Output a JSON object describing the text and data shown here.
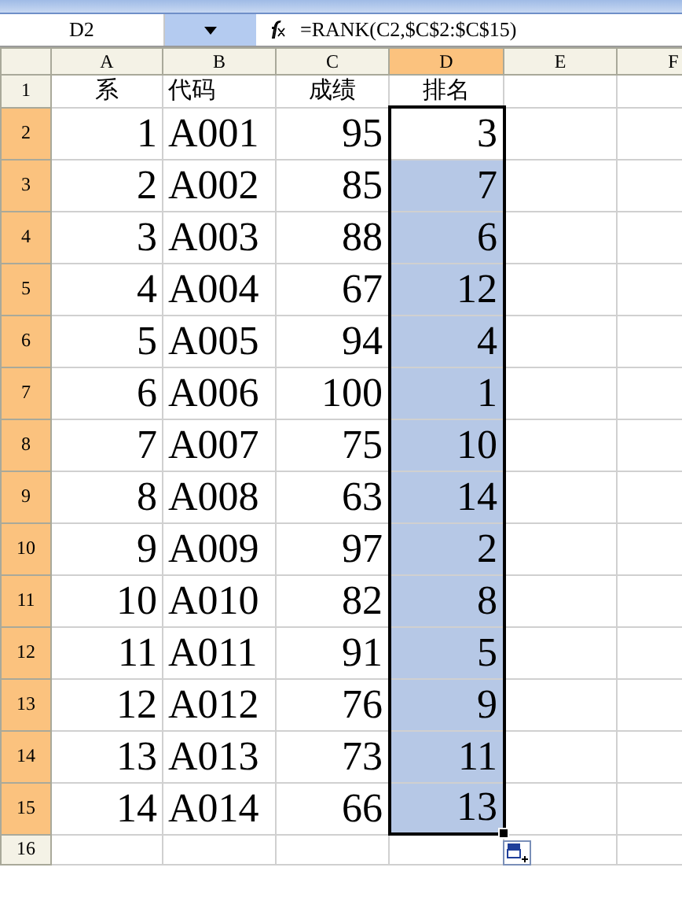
{
  "name_box": "D2",
  "formula": "=RANK(C2,$C$2:$C$15)",
  "columns": [
    {
      "label": "A",
      "selected": false
    },
    {
      "label": "B",
      "selected": false
    },
    {
      "label": "C",
      "selected": false
    },
    {
      "label": "D",
      "selected": true
    },
    {
      "label": "E",
      "selected": false
    },
    {
      "label": "F",
      "selected": false
    }
  ],
  "rows": [
    {
      "number": "1",
      "selected": false,
      "cells": [
        {
          "text": "系",
          "selected": false,
          "active": false
        },
        {
          "text": "代码",
          "selected": false,
          "active": false
        },
        {
          "text": "成绩",
          "selected": false,
          "active": false
        },
        {
          "text": "排名",
          "selected": false,
          "active": false
        }
      ]
    },
    {
      "number": "2",
      "selected": true,
      "cells": [
        {
          "text": "1",
          "selected": false,
          "active": false
        },
        {
          "text": "A001",
          "selected": false,
          "active": false
        },
        {
          "text": "95",
          "selected": false,
          "active": false
        },
        {
          "text": "3",
          "selected": true,
          "active": true
        }
      ]
    },
    {
      "number": "3",
      "selected": true,
      "cells": [
        {
          "text": "2",
          "selected": false,
          "active": false
        },
        {
          "text": "A002",
          "selected": false,
          "active": false
        },
        {
          "text": "85",
          "selected": false,
          "active": false
        },
        {
          "text": "7",
          "selected": true,
          "active": false
        }
      ]
    },
    {
      "number": "4",
      "selected": true,
      "cells": [
        {
          "text": "3",
          "selected": false,
          "active": false
        },
        {
          "text": "A003",
          "selected": false,
          "active": false
        },
        {
          "text": "88",
          "selected": false,
          "active": false
        },
        {
          "text": "6",
          "selected": true,
          "active": false
        }
      ]
    },
    {
      "number": "5",
      "selected": true,
      "cells": [
        {
          "text": "4",
          "selected": false,
          "active": false
        },
        {
          "text": "A004",
          "selected": false,
          "active": false
        },
        {
          "text": "67",
          "selected": false,
          "active": false
        },
        {
          "text": "12",
          "selected": true,
          "active": false
        }
      ]
    },
    {
      "number": "6",
      "selected": true,
      "cells": [
        {
          "text": "5",
          "selected": false,
          "active": false
        },
        {
          "text": "A005",
          "selected": false,
          "active": false
        },
        {
          "text": "94",
          "selected": false,
          "active": false
        },
        {
          "text": "4",
          "selected": true,
          "active": false
        }
      ]
    },
    {
      "number": "7",
      "selected": true,
      "cells": [
        {
          "text": "6",
          "selected": false,
          "active": false
        },
        {
          "text": "A006",
          "selected": false,
          "active": false
        },
        {
          "text": "100",
          "selected": false,
          "active": false
        },
        {
          "text": "1",
          "selected": true,
          "active": false
        }
      ]
    },
    {
      "number": "8",
      "selected": true,
      "cells": [
        {
          "text": "7",
          "selected": false,
          "active": false
        },
        {
          "text": "A007",
          "selected": false,
          "active": false
        },
        {
          "text": "75",
          "selected": false,
          "active": false
        },
        {
          "text": "10",
          "selected": true,
          "active": false
        }
      ]
    },
    {
      "number": "9",
      "selected": true,
      "cells": [
        {
          "text": "8",
          "selected": false,
          "active": false
        },
        {
          "text": "A008",
          "selected": false,
          "active": false
        },
        {
          "text": "63",
          "selected": false,
          "active": false
        },
        {
          "text": "14",
          "selected": true,
          "active": false
        }
      ]
    },
    {
      "number": "10",
      "selected": true,
      "cells": [
        {
          "text": "9",
          "selected": false,
          "active": false
        },
        {
          "text": "A009",
          "selected": false,
          "active": false
        },
        {
          "text": "97",
          "selected": false,
          "active": false
        },
        {
          "text": "2",
          "selected": true,
          "active": false
        }
      ]
    },
    {
      "number": "11",
      "selected": true,
      "cells": [
        {
          "text": "10",
          "selected": false,
          "active": false
        },
        {
          "text": "A010",
          "selected": false,
          "active": false
        },
        {
          "text": "82",
          "selected": false,
          "active": false
        },
        {
          "text": "8",
          "selected": true,
          "active": false
        }
      ]
    },
    {
      "number": "12",
      "selected": true,
      "cells": [
        {
          "text": "11",
          "selected": false,
          "active": false
        },
        {
          "text": "A011",
          "selected": false,
          "active": false
        },
        {
          "text": "91",
          "selected": false,
          "active": false
        },
        {
          "text": "5",
          "selected": true,
          "active": false
        }
      ]
    },
    {
      "number": "13",
      "selected": true,
      "cells": [
        {
          "text": "12",
          "selected": false,
          "active": false
        },
        {
          "text": "A012",
          "selected": false,
          "active": false
        },
        {
          "text": "76",
          "selected": false,
          "active": false
        },
        {
          "text": "9",
          "selected": true,
          "active": false
        }
      ]
    },
    {
      "number": "14",
      "selected": true,
      "cells": [
        {
          "text": "13",
          "selected": false,
          "active": false
        },
        {
          "text": "A013",
          "selected": false,
          "active": false
        },
        {
          "text": "73",
          "selected": false,
          "active": false
        },
        {
          "text": "11",
          "selected": true,
          "active": false
        }
      ]
    },
    {
      "number": "15",
      "selected": true,
      "cells": [
        {
          "text": "14",
          "selected": false,
          "active": false
        },
        {
          "text": "A014",
          "selected": false,
          "active": false
        },
        {
          "text": "66",
          "selected": false,
          "active": false
        },
        {
          "text": "13",
          "selected": true,
          "active": false
        }
      ]
    },
    {
      "number": "16",
      "selected": false
    }
  ]
}
